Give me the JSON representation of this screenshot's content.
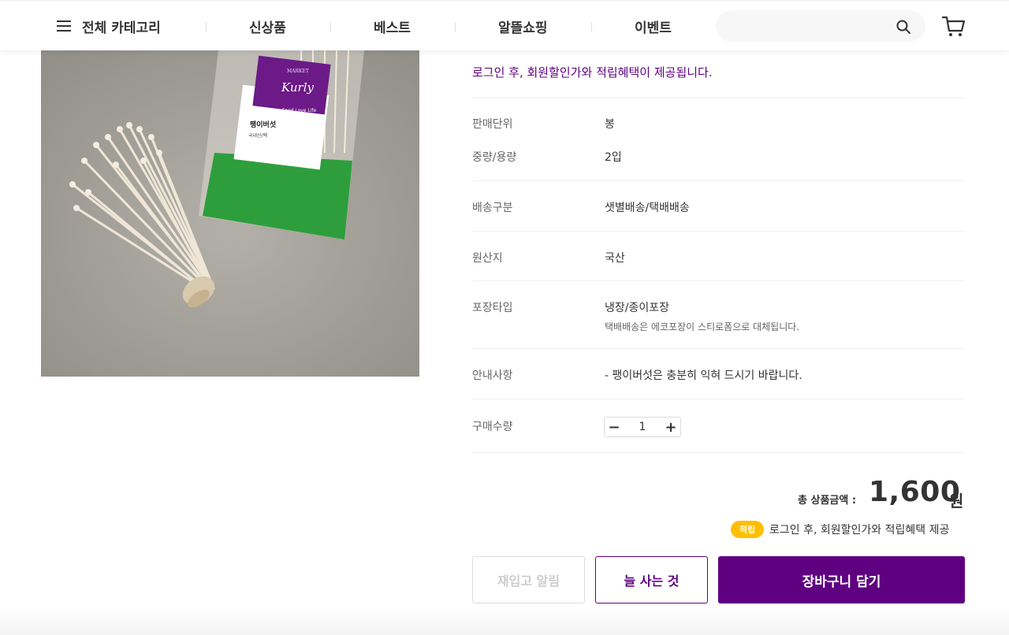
{
  "header": {
    "category_label": "전체 카테고리",
    "nav": [
      "신상품",
      "베스트",
      "알뜰쇼핑",
      "이벤트"
    ],
    "search": {
      "placeholder": ""
    }
  },
  "product_image": {
    "brand": "MARKET",
    "brand_script": "Kurly",
    "tagline": "Love Food Love Life",
    "label_name": "팽이버섯",
    "label_origin": "국내산/팩"
  },
  "product_info": {
    "login_note": "로그인 후, 회원할인가와 적립혜택이 제공됩니다.",
    "rows": [
      {
        "label": "판매단위",
        "value": "봉"
      },
      {
        "label": "중량/용량",
        "value": "2입"
      },
      {
        "label": "배송구분",
        "value": "샛별배송/택배배송"
      },
      {
        "label": "원산지",
        "value": "국산"
      },
      {
        "label": "포장타입",
        "value": "냉장/종이포장",
        "sub": "택배배송은 에코포장이 스티로폼으로 대체됩니다."
      },
      {
        "label": "안내사항",
        "value": "- 팽이버섯은 충분히 익혀 드시기 바랍니다."
      },
      {
        "label": "구매수량"
      }
    ],
    "quantity": "1"
  },
  "total": {
    "label": "총 상품금액 :",
    "amount": "1,600",
    "unit": "원",
    "badge": "적립",
    "reward_note": "로그인 후, 회원할인가와 적립혜택 제공"
  },
  "buttons": {
    "restock": "재입고 알림",
    "often": "늘 사는 것",
    "cart": "장바구니 담기"
  },
  "colors": {
    "accent": "#5f0080",
    "badge": "#ffbf00"
  }
}
